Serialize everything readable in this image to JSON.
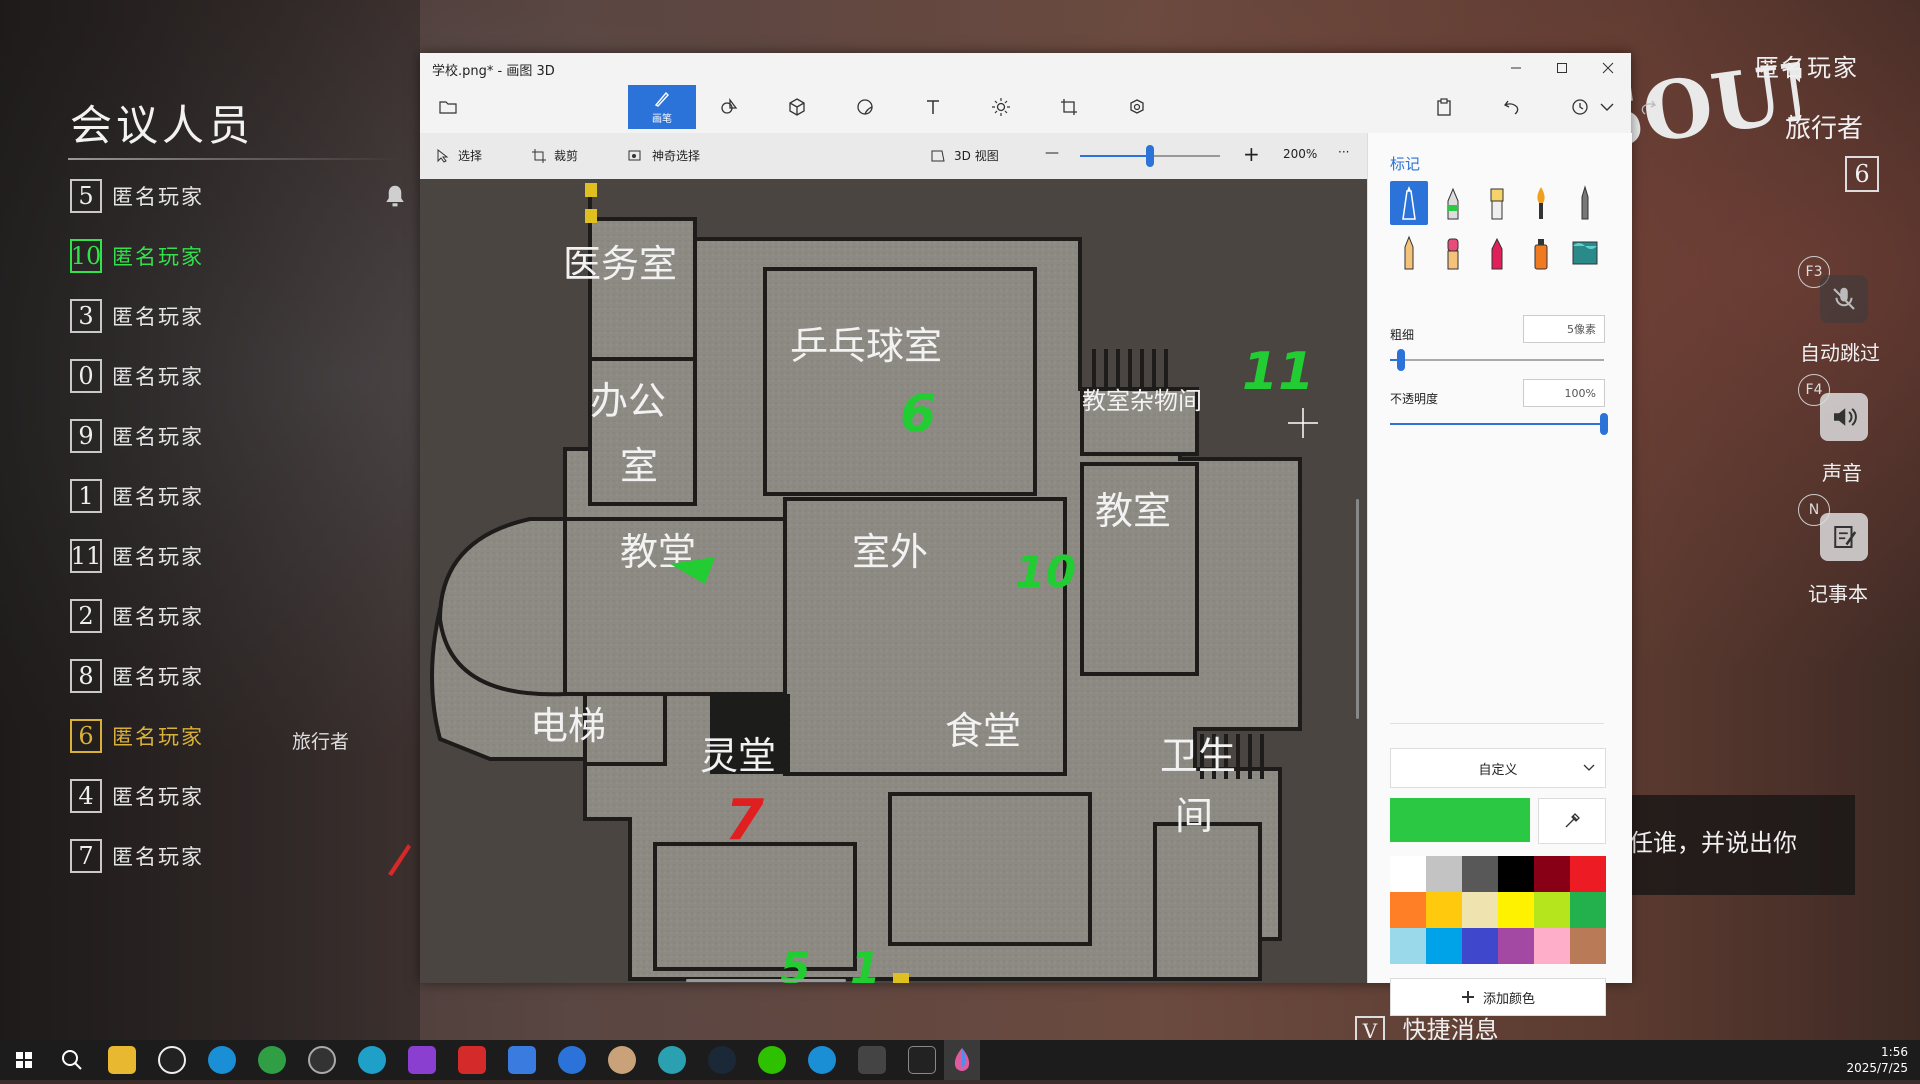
{
  "game": {
    "panel_title": "会议人员",
    "players": [
      {
        "num": "5",
        "name": "匿名玩家",
        "style": "normal"
      },
      {
        "num": "10",
        "name": "匿名玩家",
        "style": "green"
      },
      {
        "num": "3",
        "name": "匿名玩家",
        "style": "normal"
      },
      {
        "num": "0",
        "name": "匿名玩家",
        "style": "normal"
      },
      {
        "num": "9",
        "name": "匿名玩家",
        "style": "normal"
      },
      {
        "num": "1",
        "name": "匿名玩家",
        "style": "normal"
      },
      {
        "num": "11",
        "name": "匿名玩家",
        "style": "normal"
      },
      {
        "num": "2",
        "name": "匿名玩家",
        "style": "normal"
      },
      {
        "num": "8",
        "name": "匿名玩家",
        "style": "normal"
      },
      {
        "num": "6",
        "name": "匿名玩家",
        "style": "gold"
      },
      {
        "num": "4",
        "name": "匿名玩家",
        "style": "normal"
      },
      {
        "num": "7",
        "name": "匿名玩家",
        "style": "normal"
      }
    ],
    "role_tag": "旅行者",
    "hud": {
      "player_name": "匿名玩家",
      "role": "旅行者",
      "player_number": "6",
      "logo_text": "SOUNDS",
      "auto_skip_key": "F3",
      "auto_skip_label": "自动跳过",
      "sound_key": "F4",
      "sound_label": "声音",
      "notebook_key": "N",
      "notebook_label": "记事本",
      "chat_text": "信任谁，并说出你",
      "quick_msg_key": "V",
      "quick_msg_label": "快捷消息"
    }
  },
  "paint3d": {
    "window_title": "学校.png* - 画图 3D",
    "active_tool_label": "画笔",
    "subbar": {
      "select": "选择",
      "crop": "裁剪",
      "magic_select": "神奇选择",
      "view3d": "3D 视图",
      "zoom_minus": "—",
      "zoom_plus": "+",
      "zoom": "200%",
      "more": "···",
      "zoom_level": 0.5
    },
    "side": {
      "title": "标记",
      "thickness_label": "粗细",
      "thickness_value": "5像素",
      "thickness_level": 0.05,
      "opacity_label": "不透明度",
      "opacity_value": "100%",
      "opacity_level": 1.0,
      "color_mode": "自定义",
      "current_color": "#2bc843",
      "add_color": "添加颜色",
      "palette": [
        "#ffffff",
        "#c3c3c3",
        "#585858",
        "#000000",
        "#880015",
        "#ed1c24",
        "#ff7f27",
        "#ffc90e",
        "#efe4b0",
        "#fff200",
        "#b5e61d",
        "#22b14c",
        "#99d9ea",
        "#00a2e8",
        "#3f48cc",
        "#a349a4",
        "#ffaec9",
        "#b97a57"
      ]
    },
    "map": {
      "rooms": [
        "医务室",
        "乒乓球室",
        "办公",
        "室",
        "教室杂物间",
        "教室",
        "教堂",
        "室外",
        "电梯",
        "灵堂",
        "食堂",
        "卫生",
        "间"
      ],
      "marks": [
        "11",
        "6",
        "10",
        "7",
        "5",
        "1"
      ]
    }
  },
  "taskbar": {
    "time": "1:56",
    "date": "2025/7/25"
  }
}
